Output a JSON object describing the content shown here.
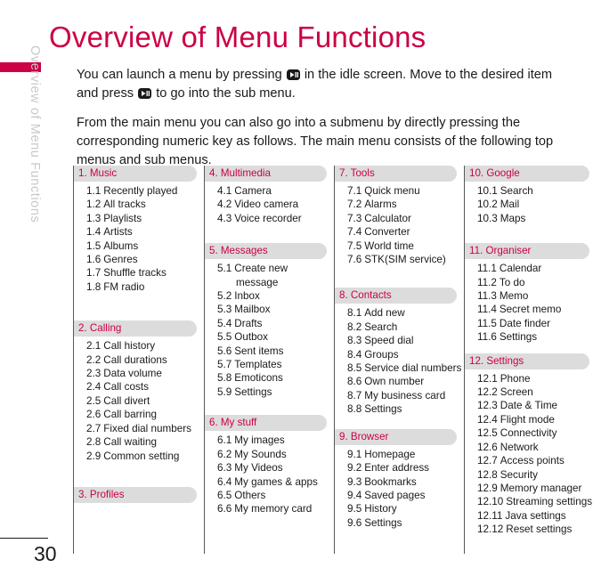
{
  "page": {
    "title": "Overview of Menu Functions",
    "side_tab_label": "Overview of Menu Functions",
    "page_number": "30",
    "accent_color": "#cc0044",
    "header_bar_color": "#dcdcdc",
    "rule_color": "#58585a"
  },
  "intro": {
    "paragraph_1_part_1": "You can launch a menu by pressing",
    "paragraph_1_part_2": "in the idle screen. Move to the desired item and press",
    "paragraph_1_part_3": "to go into the sub menu.",
    "paragraph_2": "From the main menu you can also go into a submenu by directly pressing the corresponding numeric key as follows. The main menu consists of the following top menus and sub menus.",
    "key_icon_1": "play-pause-key-icon",
    "key_icon_2": "play-pause-key-icon"
  },
  "columns": [
    {
      "groups": [
        {
          "header": "1. Music",
          "items": [
            {
              "num": "1.1",
              "label": "Recently played"
            },
            {
              "num": "1.2",
              "label": "All tracks"
            },
            {
              "num": "1.3",
              "label": "Playlists"
            },
            {
              "num": "1.4",
              "label": "Artists"
            },
            {
              "num": "1.5",
              "label": "Albums"
            },
            {
              "num": "1.6",
              "label": "Genres"
            },
            {
              "num": "1.7",
              "label": "Shuffle tracks"
            },
            {
              "num": "1.8",
              "label": "FM radio"
            }
          ]
        },
        {
          "header": "2. Calling",
          "items": [
            {
              "num": "2.1",
              "label": "Call history"
            },
            {
              "num": "2.2",
              "label": "Call durations"
            },
            {
              "num": "2.3",
              "label": "Data volume"
            },
            {
              "num": "2.4",
              "label": "Call costs"
            },
            {
              "num": "2.5",
              "label": "Call divert"
            },
            {
              "num": "2.6",
              "label": "Call barring"
            },
            {
              "num": "2.7",
              "label": "Fixed dial numbers"
            },
            {
              "num": "2.8",
              "label": "Call waiting"
            },
            {
              "num": "2.9",
              "label": "Common setting"
            }
          ]
        },
        {
          "header": "3. Profiles",
          "items": []
        }
      ]
    },
    {
      "groups": [
        {
          "header": "4. Multimedia",
          "items": [
            {
              "num": "4.1",
              "label": "Camera"
            },
            {
              "num": "4.2",
              "label": "Video camera"
            },
            {
              "num": "4.3",
              "label": "Voice recorder"
            }
          ]
        },
        {
          "header": "5. Messages",
          "items": [
            {
              "num": "5.1",
              "label": "Create new"
            },
            {
              "num": "",
              "label": "message",
              "continuation": true
            },
            {
              "num": "5.2",
              "label": "Inbox"
            },
            {
              "num": "5.3",
              "label": "Mailbox"
            },
            {
              "num": "5.4",
              "label": "Drafts"
            },
            {
              "num": "5.5",
              "label": "Outbox"
            },
            {
              "num": "5.6",
              "label": "Sent items"
            },
            {
              "num": "5.7",
              "label": "Templates"
            },
            {
              "num": "5.8",
              "label": "Emoticons"
            },
            {
              "num": "5.9",
              "label": "Settings"
            }
          ]
        },
        {
          "header": "6. My stuff",
          "items": [
            {
              "num": "6.1",
              "label": "My images"
            },
            {
              "num": "6.2",
              "label": "My Sounds"
            },
            {
              "num": "6.3",
              "label": "My Videos"
            },
            {
              "num": "6.4",
              "label": "My games & apps"
            },
            {
              "num": "6.5",
              "label": "Others"
            },
            {
              "num": "6.6",
              "label": "My memory card"
            }
          ]
        }
      ]
    },
    {
      "groups": [
        {
          "header": "7. Tools",
          "items": [
            {
              "num": "7.1",
              "label": "Quick menu"
            },
            {
              "num": "7.2",
              "label": "Alarms"
            },
            {
              "num": "7.3",
              "label": "Calculator"
            },
            {
              "num": "7.4",
              "label": "Converter"
            },
            {
              "num": "7.5",
              "label": "World time"
            },
            {
              "num": "7.6",
              "label": "STK(SIM service)"
            }
          ]
        },
        {
          "header": "8. Contacts",
          "items": [
            {
              "num": "8.1",
              "label": "Add new"
            },
            {
              "num": "8.2",
              "label": "Search"
            },
            {
              "num": "8.3",
              "label": "Speed dial"
            },
            {
              "num": "8.4",
              "label": "Groups"
            },
            {
              "num": "8.5",
              "label": "Service dial numbers"
            },
            {
              "num": "8.6",
              "label": "Own number"
            },
            {
              "num": "8.7",
              "label": "My business card"
            },
            {
              "num": "8.8",
              "label": "Settings"
            }
          ]
        },
        {
          "header": "9. Browser",
          "items": [
            {
              "num": "9.1",
              "label": "Homepage"
            },
            {
              "num": "9.2",
              "label": "Enter address"
            },
            {
              "num": "9.3",
              "label": "Bookmarks"
            },
            {
              "num": "9.4",
              "label": "Saved pages"
            },
            {
              "num": "9.5",
              "label": "History"
            },
            {
              "num": "9.6",
              "label": "Settings"
            }
          ]
        }
      ]
    },
    {
      "groups": [
        {
          "header": "10. Google",
          "items": [
            {
              "num": "10.1",
              "label": "Search"
            },
            {
              "num": "10.2",
              "label": "Mail"
            },
            {
              "num": "10.3",
              "label": "Maps"
            }
          ]
        },
        {
          "header": "11. Organiser",
          "items": [
            {
              "num": "11.1",
              "label": "Calendar"
            },
            {
              "num": "11.2",
              "label": "To do"
            },
            {
              "num": "11.3",
              "label": "Memo"
            },
            {
              "num": "11.4",
              "label": "Secret memo"
            },
            {
              "num": "11.5",
              "label": "Date finder"
            },
            {
              "num": "11.6",
              "label": "Settings"
            }
          ]
        },
        {
          "header": "12. Settings",
          "items": [
            {
              "num": "12.1",
              "label": "Phone"
            },
            {
              "num": "12.2",
              "label": "Screen"
            },
            {
              "num": "12.3",
              "label": "Date & Time"
            },
            {
              "num": "12.4",
              "label": "Flight mode"
            },
            {
              "num": "12.5",
              "label": "Connectivity"
            },
            {
              "num": "12.6",
              "label": "Network"
            },
            {
              "num": "12.7",
              "label": "Access points"
            },
            {
              "num": "12.8",
              "label": "Security"
            },
            {
              "num": "12.9",
              "label": "Memory manager"
            },
            {
              "num": "12.10",
              "label": "Streaming settings"
            },
            {
              "num": "12.11",
              "label": "Java settings"
            },
            {
              "num": "12.12",
              "label": "Reset settings"
            }
          ]
        }
      ]
    }
  ]
}
